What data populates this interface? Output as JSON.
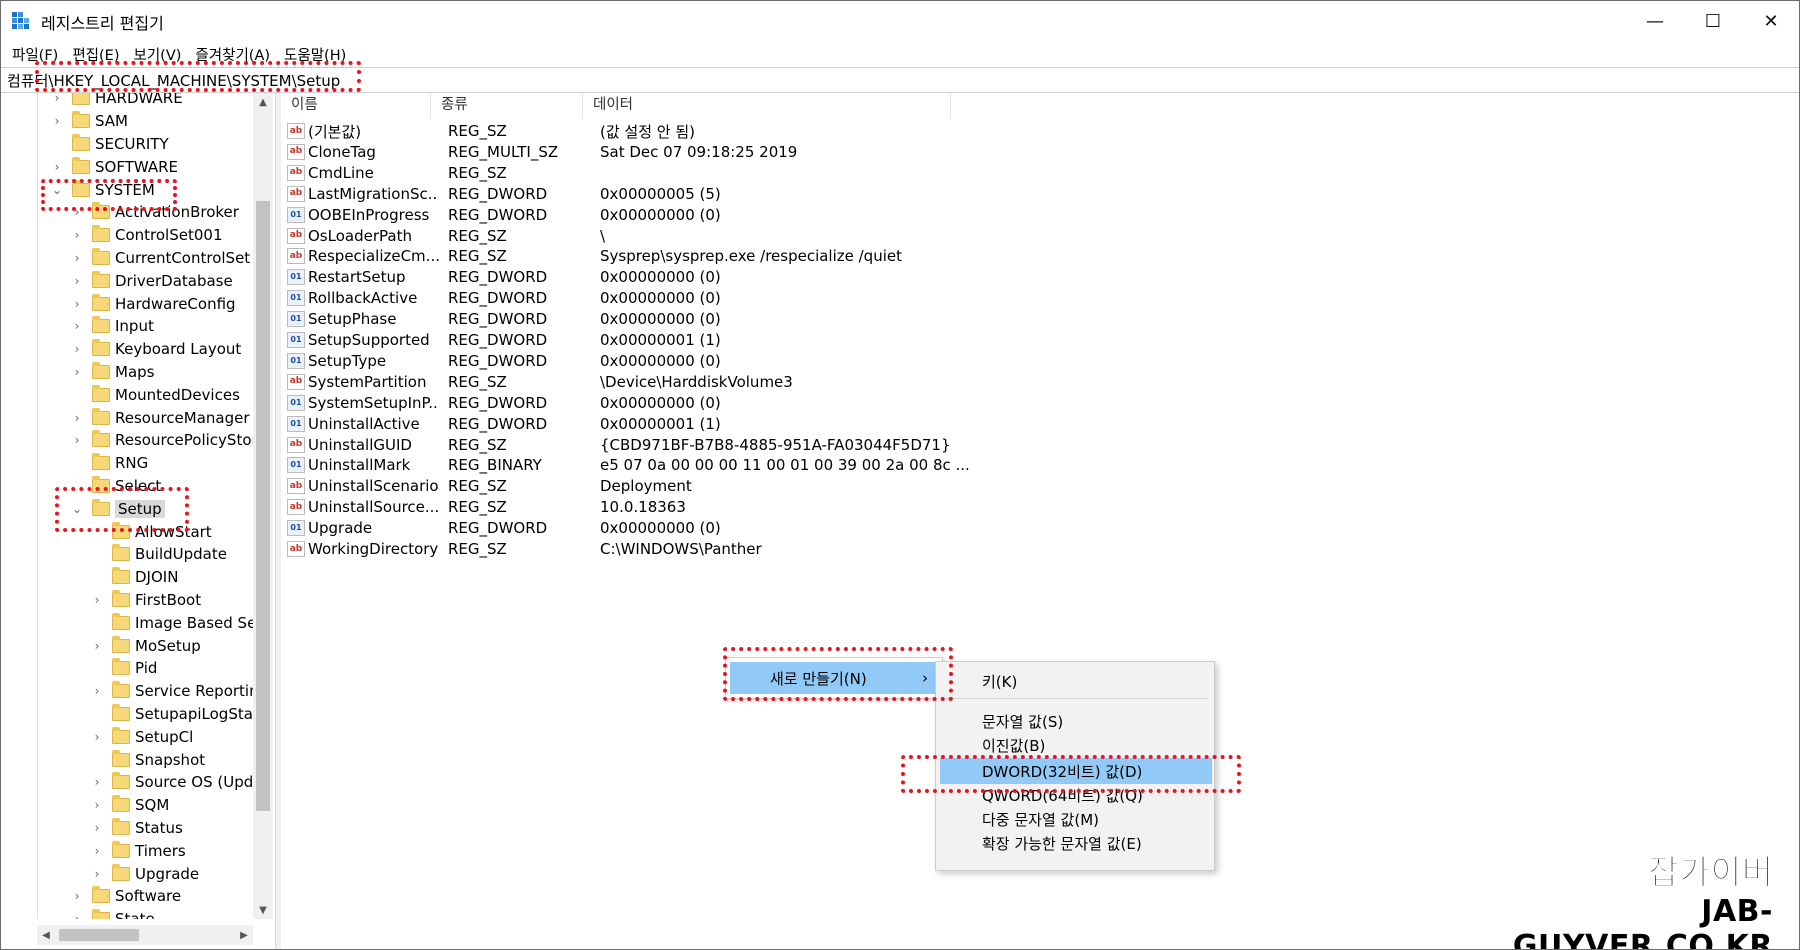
{
  "window": {
    "title": "레지스트리 편집기",
    "min": "—",
    "max": "☐",
    "close": "✕"
  },
  "menu": [
    "파일(F)",
    "편집(E)",
    "보기(V)",
    "즐겨찾기(A)",
    "도움말(H)"
  ],
  "address": "컴퓨터\\HKEY_LOCAL_MACHINE\\SYSTEM\\Setup",
  "tree": [
    {
      "label": "HARDWARE",
      "chev": "›"
    },
    {
      "label": "SAM",
      "chev": "›"
    },
    {
      "label": "SECURITY",
      "chev": ""
    },
    {
      "label": "SOFTWARE",
      "chev": "›"
    },
    {
      "label": "SYSTEM",
      "chev": "⌄"
    },
    {
      "label": "ActivationBroker",
      "chev": "›"
    },
    {
      "label": "ControlSet001",
      "chev": "›"
    },
    {
      "label": "CurrentControlSet",
      "chev": "›"
    },
    {
      "label": "DriverDatabase",
      "chev": "›"
    },
    {
      "label": "HardwareConfig",
      "chev": "›"
    },
    {
      "label": "Input",
      "chev": "›"
    },
    {
      "label": "Keyboard Layout",
      "chev": "›"
    },
    {
      "label": "Maps",
      "chev": "›"
    },
    {
      "label": "MountedDevices",
      "chev": ""
    },
    {
      "label": "ResourceManager",
      "chev": "›"
    },
    {
      "label": "ResourcePolicyStore",
      "chev": "›"
    },
    {
      "label": "RNG",
      "chev": ""
    },
    {
      "label": "Select",
      "chev": ""
    },
    {
      "label": "Setup",
      "chev": "⌄",
      "selected": true
    },
    {
      "label": "AllowStart",
      "chev": ""
    },
    {
      "label": "BuildUpdate",
      "chev": ""
    },
    {
      "label": "DJOIN",
      "chev": ""
    },
    {
      "label": "FirstBoot",
      "chev": "›"
    },
    {
      "label": "Image Based Setu",
      "chev": ""
    },
    {
      "label": "MoSetup",
      "chev": "›"
    },
    {
      "label": "Pid",
      "chev": ""
    },
    {
      "label": "Service Reporting",
      "chev": "›"
    },
    {
      "label": "SetupapiLogStatu",
      "chev": ""
    },
    {
      "label": "SetupCl",
      "chev": "›"
    },
    {
      "label": "Snapshot",
      "chev": ""
    },
    {
      "label": "Source OS (Upda",
      "chev": "›"
    },
    {
      "label": "SQM",
      "chev": "›"
    },
    {
      "label": "Status",
      "chev": "›"
    },
    {
      "label": "Timers",
      "chev": "›"
    },
    {
      "label": "Upgrade",
      "chev": "›"
    },
    {
      "label": "Software",
      "chev": "›"
    },
    {
      "label": "State",
      "chev": "›"
    }
  ],
  "tree_scroll": {
    "up": "▲",
    "down": "▼",
    "left": "◀",
    "right": "▶"
  },
  "columns": {
    "name": "이름",
    "type": "종류",
    "data": "데이터"
  },
  "values": [
    {
      "icon": "ab",
      "name": "(기본값)",
      "type": "REG_SZ",
      "data": "(값 설정 안 됨)"
    },
    {
      "icon": "ab",
      "name": "CloneTag",
      "type": "REG_MULTI_SZ",
      "data": "Sat Dec 07 09:18:25 2019"
    },
    {
      "icon": "ab",
      "name": "CmdLine",
      "type": "REG_SZ",
      "data": ""
    },
    {
      "icon": "ab",
      "name": "LastMigrationSc...",
      "type": "REG_DWORD",
      "data": "0x00000005 (5)"
    },
    {
      "icon": "01",
      "name": "OOBEInProgress",
      "type": "REG_DWORD",
      "data": "0x00000000 (0)"
    },
    {
      "icon": "ab",
      "name": "OsLoaderPath",
      "type": "REG_SZ",
      "data": "\\"
    },
    {
      "icon": "ab",
      "name": "RespecializeCm...",
      "type": "REG_SZ",
      "data": "Sysprep\\sysprep.exe /respecialize /quiet"
    },
    {
      "icon": "01",
      "name": "RestartSetup",
      "type": "REG_DWORD",
      "data": "0x00000000 (0)"
    },
    {
      "icon": "01",
      "name": "RollbackActive",
      "type": "REG_DWORD",
      "data": "0x00000000 (0)"
    },
    {
      "icon": "01",
      "name": "SetupPhase",
      "type": "REG_DWORD",
      "data": "0x00000000 (0)"
    },
    {
      "icon": "01",
      "name": "SetupSupported",
      "type": "REG_DWORD",
      "data": "0x00000001 (1)"
    },
    {
      "icon": "01",
      "name": "SetupType",
      "type": "REG_DWORD",
      "data": "0x00000000 (0)"
    },
    {
      "icon": "ab",
      "name": "SystemPartition",
      "type": "REG_SZ",
      "data": "\\Device\\HarddiskVolume3"
    },
    {
      "icon": "01",
      "name": "SystemSetupInP...",
      "type": "REG_DWORD",
      "data": "0x00000000 (0)"
    },
    {
      "icon": "01",
      "name": "UninstallActive",
      "type": "REG_DWORD",
      "data": "0x00000001 (1)"
    },
    {
      "icon": "ab",
      "name": "UninstallGUID",
      "type": "REG_SZ",
      "data": "{CBD971BF-B7B8-4885-951A-FA03044F5D71}"
    },
    {
      "icon": "01",
      "name": "UninstallMark",
      "type": "REG_BINARY",
      "data": "e5 07 0a 00 00 00 11 00 01 00 39 00 2a 00 8c ..."
    },
    {
      "icon": "ab",
      "name": "UninstallScenario",
      "type": "REG_SZ",
      "data": "Deployment"
    },
    {
      "icon": "ab",
      "name": "UninstallSource...",
      "type": "REG_SZ",
      "data": "10.0.18363"
    },
    {
      "icon": "01",
      "name": "Upgrade",
      "type": "REG_DWORD",
      "data": "0x00000000 (0)"
    },
    {
      "icon": "ab",
      "name": "WorkingDirectory",
      "type": "REG_SZ",
      "data": "C:\\WINDOWS\\Panther"
    }
  ],
  "context_menu": {
    "new": "새로 만들기(N)",
    "arrow": "›"
  },
  "submenu": [
    {
      "label": "키(K)"
    },
    {
      "label": "문자열 값(S)"
    },
    {
      "label": "이진값(B)"
    },
    {
      "label": "DWORD(32비트) 값(D)",
      "highlighted": true
    },
    {
      "label": "QWORD(64비트) 값(Q)"
    },
    {
      "label": "다중 문자열 값(M)"
    },
    {
      "label": "확장 가능한 문자열 값(E)"
    }
  ],
  "watermark": {
    "line1": "잡가이버",
    "line2": "JAB-GUYVER.CO.KR"
  },
  "colors": {
    "highlight": "#91c9f7",
    "annotation": "#e8141e",
    "folder": "#f7d878"
  }
}
